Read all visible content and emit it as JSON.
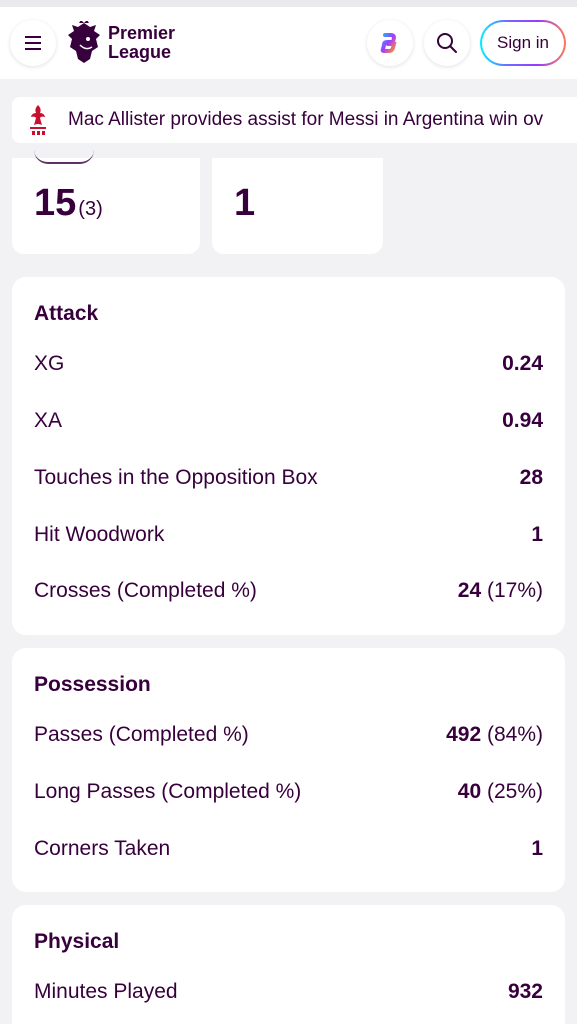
{
  "header": {
    "logo_line1": "Premier",
    "logo_line2": "League",
    "signin_label": "Sign in"
  },
  "ticker": {
    "text": "Mac Allister provides assist for Messi in Argentina win ov"
  },
  "stat_cards": [
    {
      "value": "15",
      "sub": "(3)"
    },
    {
      "value": "1",
      "sub": ""
    }
  ],
  "sections": {
    "attack": {
      "title": "Attack",
      "rows": [
        {
          "label": "XG",
          "value": "0.24",
          "pct": ""
        },
        {
          "label": "XA",
          "value": "0.94",
          "pct": ""
        },
        {
          "label": "Touches in the Opposition Box",
          "value": "28",
          "pct": ""
        },
        {
          "label": "Hit Woodwork",
          "value": "1",
          "pct": ""
        },
        {
          "label": "Crosses (Completed %)",
          "value": "24",
          "pct": " (17%)"
        }
      ]
    },
    "possession": {
      "title": "Possession",
      "rows": [
        {
          "label": "Passes (Completed %)",
          "value": "492",
          "pct": " (84%)"
        },
        {
          "label": "Long Passes (Completed %)",
          "value": "40",
          "pct": " (25%)"
        },
        {
          "label": "Corners Taken",
          "value": "1",
          "pct": ""
        }
      ]
    },
    "physical": {
      "title": "Physical",
      "rows": [
        {
          "label": "Minutes Played",
          "value": "932",
          "pct": ""
        }
      ]
    }
  },
  "colors": {
    "brand_purple": "#37003c",
    "background": "#f2f2f5",
    "liverpool_red": "#c8102e"
  }
}
